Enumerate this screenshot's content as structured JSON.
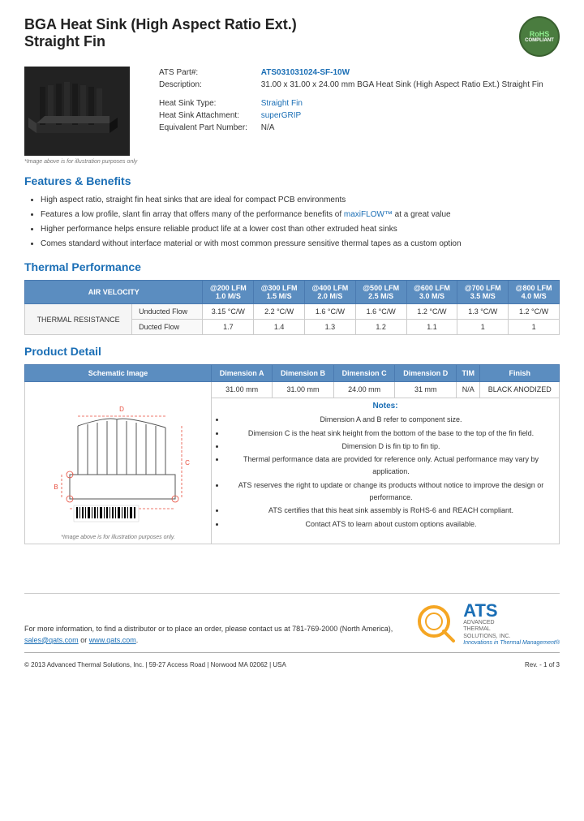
{
  "header": {
    "title_line1": "BGA Heat Sink (High Aspect Ratio Ext.)",
    "title_line2": "Straight Fin",
    "rohs": {
      "line1": "RoHS",
      "line2": "COMPLIANT"
    }
  },
  "product": {
    "part_label": "ATS Part#:",
    "part_value": "ATS031031024-SF-10W",
    "description_label": "Description:",
    "description_value": "31.00 x 31.00 x 24.00 mm BGA Heat Sink (High Aspect Ratio Ext.) Straight Fin",
    "heat_sink_type_label": "Heat Sink Type:",
    "heat_sink_type_value": "Straight Fin",
    "attachment_label": "Heat Sink Attachment:",
    "attachment_value": "superGRIP",
    "equiv_part_label": "Equivalent Part Number:",
    "equiv_part_value": "N/A",
    "image_caption": "*Image above is for illustration purposes only"
  },
  "features": {
    "section_title": "Features & Benefits",
    "items": [
      "High aspect ratio, straight fin heat sinks that are ideal for compact PCB environments",
      "Features a low profile, slant fin array that offers many of the performance benefits of maxiFLOW™ at a great value",
      "Higher performance helps ensure reliable product life at a lower cost than other extruded heat sinks",
      "Comes standard without interface material or with most common pressure sensitive thermal tapes as a custom option"
    ]
  },
  "thermal_performance": {
    "section_title": "Thermal Performance",
    "table": {
      "col_header_airvelocity": "AIR VELOCITY",
      "columns": [
        {
          "lfm": "@200 LFM",
          "ms": "1.0 M/S"
        },
        {
          "lfm": "@300 LFM",
          "ms": "1.5 M/S"
        },
        {
          "lfm": "@400 LFM",
          "ms": "2.0 M/S"
        },
        {
          "lfm": "@500 LFM",
          "ms": "2.5 M/S"
        },
        {
          "lfm": "@600 LFM",
          "ms": "3.0 M/S"
        },
        {
          "lfm": "@700 LFM",
          "ms": "3.5 M/S"
        },
        {
          "lfm": "@800 LFM",
          "ms": "4.0 M/S"
        }
      ],
      "row_label": "THERMAL RESISTANCE",
      "rows": [
        {
          "flow": "Unducted Flow",
          "values": [
            "3.15 °C/W",
            "2.2 °C/W",
            "1.6 °C/W",
            "1.6 °C/W",
            "1.2 °C/W",
            "1.3 °C/W",
            "1.2 °C/W"
          ]
        },
        {
          "flow": "Ducted Flow",
          "values": [
            "1.7",
            "1.4",
            "1.3",
            "1.2",
            "1.1",
            "1",
            "1"
          ]
        }
      ]
    }
  },
  "product_detail": {
    "section_title": "Product Detail",
    "table_headers": [
      "Schematic Image",
      "Dimension A",
      "Dimension B",
      "Dimension C",
      "Dimension D",
      "TIM",
      "Finish"
    ],
    "dimensions": {
      "dim_a": "31.00 mm",
      "dim_b": "31.00 mm",
      "dim_c": "24.00 mm",
      "dim_d": "31 mm",
      "tim": "N/A",
      "finish": "BLACK ANODIZED"
    },
    "schematic_caption": "*Image above is for illustration purposes only.",
    "notes_label": "Notes:",
    "notes": [
      "Dimension A and B refer to component size.",
      "Dimension C is the heat sink height from the bottom of the base to the top of the fin field.",
      "Dimension D is fin tip to fin tip.",
      "Thermal performance data are provided for reference only. Actual performance may vary by application.",
      "ATS reserves the right to update or change its products without notice to improve the design or performance.",
      "ATS certifies that this heat sink assembly is RoHS-6 and REACH compliant.",
      "Contact ATS to learn about custom options available."
    ]
  },
  "footer": {
    "contact_text": "For more information, to find a distributor or to place an order, please contact us at 781-769-2000 (North America),",
    "email": "sales@qats.com",
    "or_text": "or",
    "website": "www.qats.com",
    "copyright": "© 2013 Advanced Thermal Solutions, Inc. | 59-27 Access Road | Norwood MA  02062 | USA",
    "page_num": "Rev. - 1 of 3",
    "ats_tagline": "Innovations in Thermal Management®",
    "ats_name": "ADVANCED\nTHERMAL\nSOLUTIONS, INC."
  }
}
